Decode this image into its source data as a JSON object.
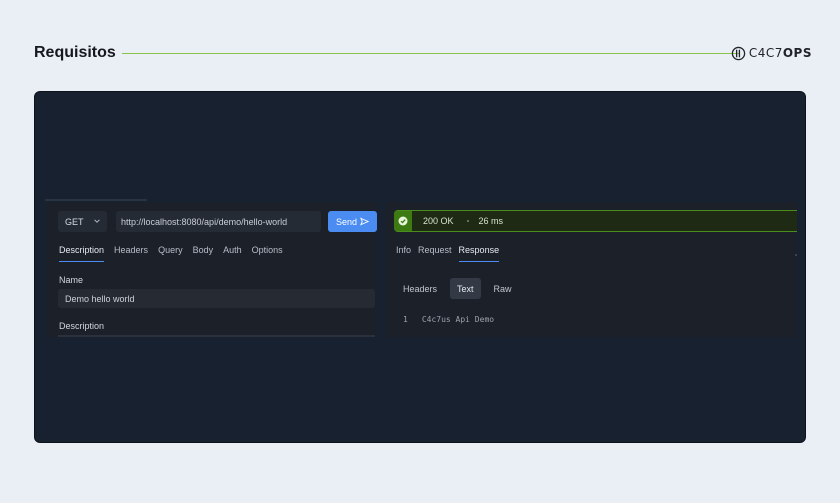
{
  "page": {
    "title": "Requisitos"
  },
  "logo": {
    "text_light": "C4C7",
    "text_bold": "OPS"
  },
  "request": {
    "method": "GET",
    "url": "http://localhost:8080/api/demo/hello-world",
    "send_label": "Send",
    "tabs": [
      {
        "label": "Description",
        "active": true
      },
      {
        "label": "Headers"
      },
      {
        "label": "Query"
      },
      {
        "label": "Body"
      },
      {
        "label": "Auth"
      },
      {
        "label": "Options"
      }
    ],
    "name_label": "Name",
    "name_value": "Demo hello world",
    "description_label": "Description"
  },
  "response": {
    "status": "200 OK",
    "time": "26 ms",
    "tabs": [
      {
        "label": "Info"
      },
      {
        "label": "Request"
      },
      {
        "label": "Response",
        "active": true
      }
    ],
    "subtabs": [
      {
        "label": "Headers"
      },
      {
        "label": "Text",
        "active": true
      },
      {
        "label": "Raw"
      }
    ],
    "body_lines": [
      {
        "line": "1",
        "text": "C4c7us Api Demo"
      }
    ]
  },
  "colors": {
    "accent": "#4a8cf2",
    "success": "#4b8d1c",
    "title_rule": "#8bc34a",
    "stage_bg": "#172130"
  }
}
